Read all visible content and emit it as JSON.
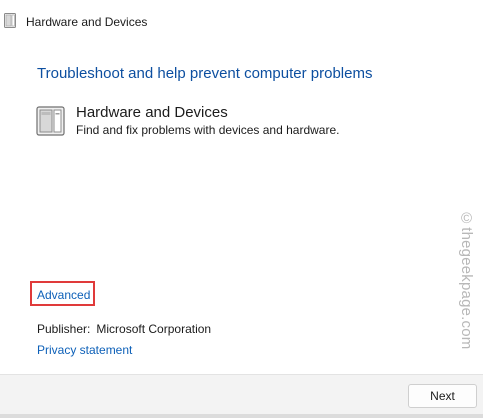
{
  "window": {
    "title": "Hardware and Devices",
    "app_icon": "troubleshooter-icon"
  },
  "main": {
    "heading": "Troubleshoot and help prevent computer problems",
    "item": {
      "icon": "hardware-devices-icon",
      "title": "Hardware and Devices",
      "description": "Find and fix problems with devices and hardware."
    },
    "advanced_link": "Advanced",
    "publisher_label": "Publisher:",
    "publisher_value": "Microsoft Corporation",
    "privacy_link": "Privacy statement"
  },
  "watermark": "©thegeekpage.com",
  "footer": {
    "next_label": "Next"
  },
  "colors": {
    "heading": "#0d4fa0",
    "link": "#0d60b8",
    "highlight_box": "#e03a3a",
    "footer_bg": "#f3f3f3"
  }
}
